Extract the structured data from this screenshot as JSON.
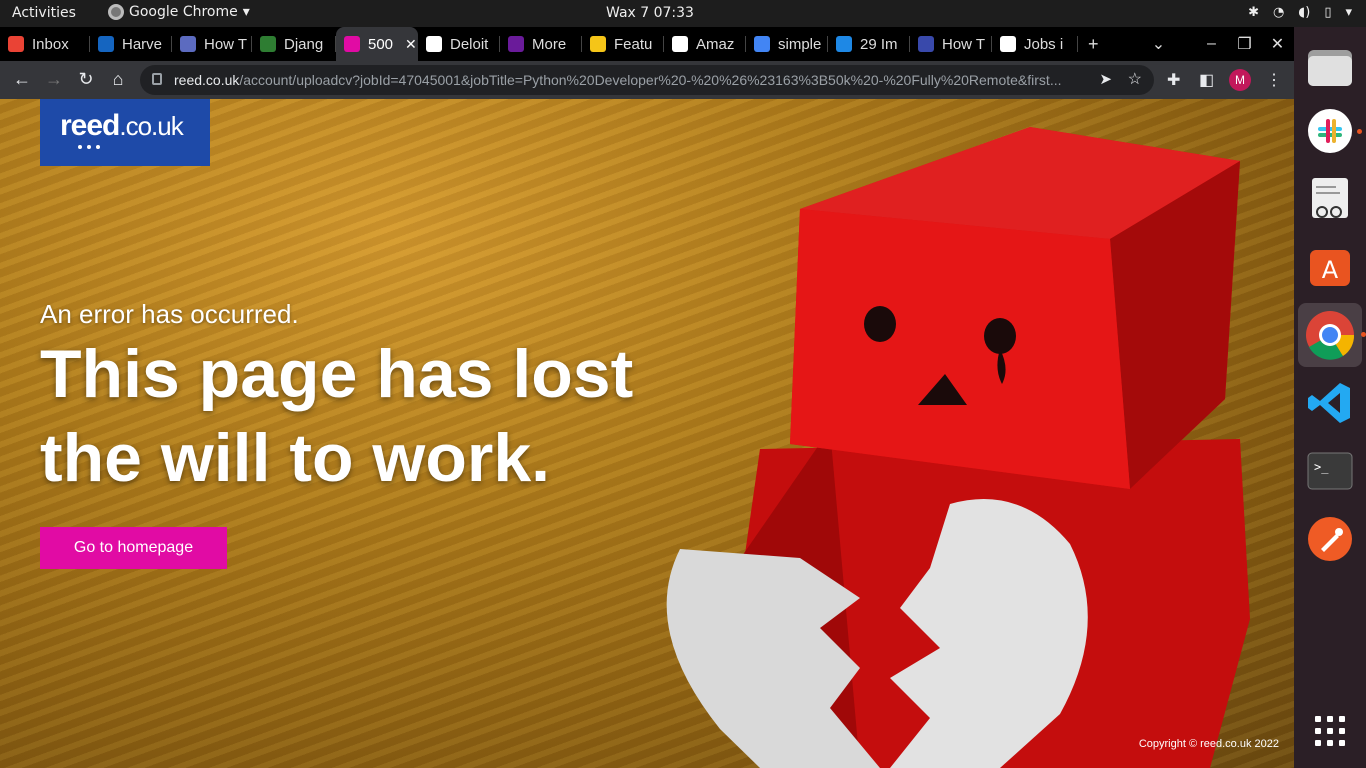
{
  "topbar": {
    "activities": "Activities",
    "app_name": "Google Chrome",
    "clock": "Wax 7  07:33"
  },
  "tabs": [
    {
      "label": "Inbox",
      "favicon": "gmail-icon",
      "color": "#ea4335"
    },
    {
      "label": "Harve",
      "favicon": "harvest-icon",
      "color": "#1565c0"
    },
    {
      "label": "How T",
      "favicon": "loading-icon",
      "color": "#5c6bc0"
    },
    {
      "label": "Djang",
      "favicon": "django-icon",
      "color": "#2e7d32"
    },
    {
      "label": "500",
      "favicon": "reed-icon",
      "color": "#e10ba4",
      "active": true
    },
    {
      "label": "Deloit",
      "favicon": "globe-icon",
      "color": "#ffffff"
    },
    {
      "label": "More",
      "favicon": "f-icon",
      "color": "#6a1b9a"
    },
    {
      "label": "Featu",
      "favicon": "imdb-icon",
      "color": "#f5c518"
    },
    {
      "label": "Amaz",
      "favicon": "amazon-icon",
      "color": "#ffffff"
    },
    {
      "label": "simple",
      "favicon": "google-icon",
      "color": "#4285f4"
    },
    {
      "label": "29 Im",
      "favicon": "chart-icon",
      "color": "#1e88e5"
    },
    {
      "label": "How T",
      "favicon": "info-icon",
      "color": "#3949ab"
    },
    {
      "label": "Jobs i",
      "favicon": "mjm-icon",
      "color": "#ffffff"
    }
  ],
  "toolbar": {
    "url_host": "reed.co.uk",
    "url_path": "/account/uploadcv?jobId=47045001&jobTitle=Python%20Developer%20-%20%26%23163%3B50k%20-%20Fully%20Remote&first...",
    "profile_initial": "M"
  },
  "page": {
    "logo_main": "reed",
    "logo_tld": ".co.uk",
    "error_subtitle": "An error has occurred.",
    "error_title": "This page has lost the will to work.",
    "button_label": "Go to homepage",
    "copyright": "Copyright © reed.co.uk 2022",
    "accent_color": "#e10ba4",
    "logo_color": "#1e4aa8"
  },
  "dock": {
    "items": [
      "files-icon",
      "slack-icon",
      "document-viewer-icon",
      "app-center-icon",
      "chrome-icon",
      "vscode-icon",
      "terminal-icon",
      "postman-icon",
      "app-grid-icon"
    ]
  }
}
